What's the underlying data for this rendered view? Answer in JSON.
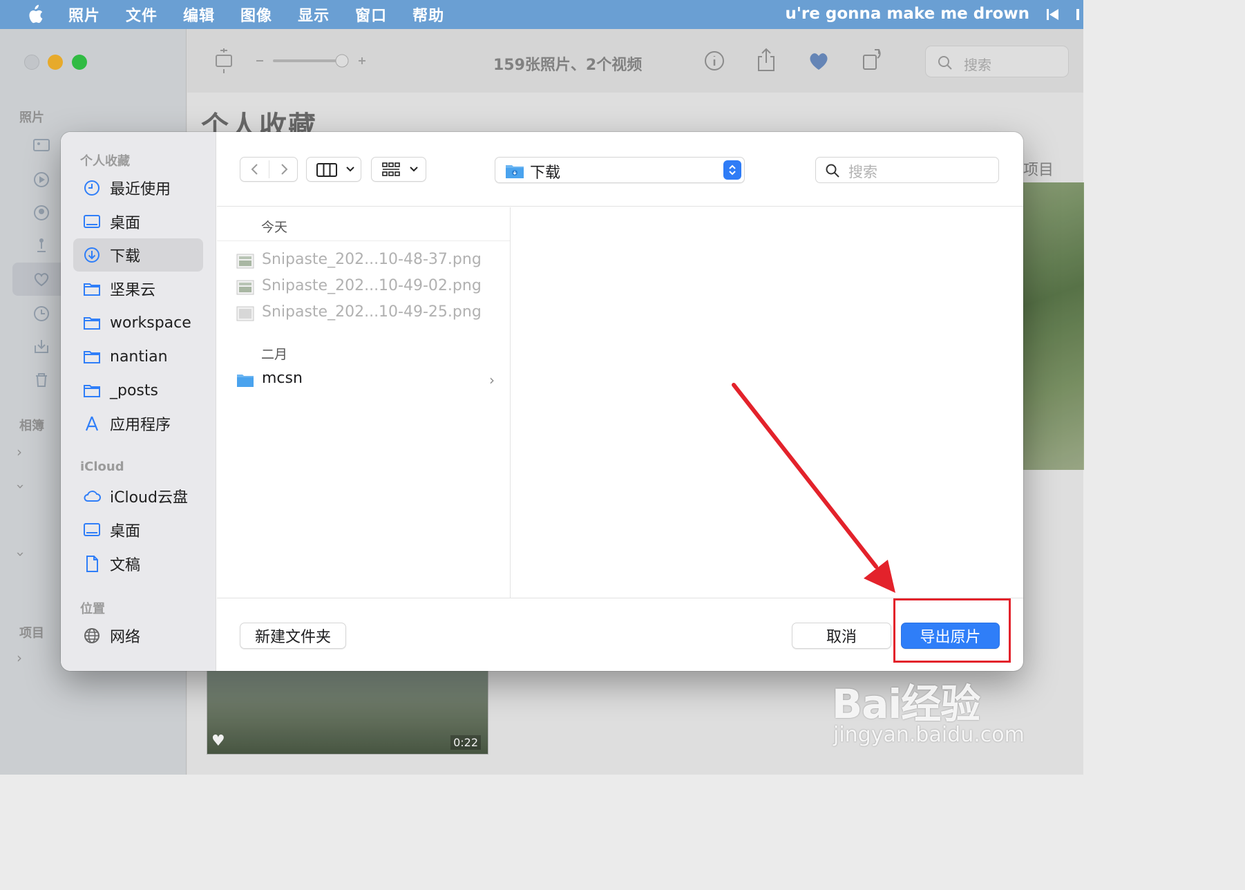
{
  "menubar": {
    "items": [
      "照片",
      "文件",
      "编辑",
      "图像",
      "显示",
      "窗口",
      "帮助"
    ],
    "now_playing": "u're gonna make me drown"
  },
  "background": {
    "sidebar": {
      "section_photos": "照片",
      "section_albums": "相簿",
      "section_projects": "项目"
    },
    "toolbar": {
      "count": "159张照片、2个视频",
      "search_placeholder": "搜索"
    },
    "title": "个人收藏",
    "right_label": "项目",
    "thumb_duration": "0:22"
  },
  "dialog": {
    "sidebar": {
      "favorites_header": "个人收藏",
      "favorites": [
        {
          "label": "最近使用",
          "icon": "clock-icon"
        },
        {
          "label": "桌面",
          "icon": "desktop-icon"
        },
        {
          "label": "下载",
          "icon": "download-icon",
          "selected": true
        },
        {
          "label": "坚果云",
          "icon": "folder-icon"
        },
        {
          "label": "workspace",
          "icon": "folder-icon"
        },
        {
          "label": "nantian",
          "icon": "folder-icon"
        },
        {
          "label": "_posts",
          "icon": "folder-icon"
        },
        {
          "label": "应用程序",
          "icon": "applications-icon"
        }
      ],
      "icloud_header": "iCloud",
      "icloud": [
        {
          "label": "iCloud云盘",
          "icon": "cloud-icon"
        },
        {
          "label": "桌面",
          "icon": "desktop-icon"
        },
        {
          "label": "文稿",
          "icon": "document-icon"
        }
      ],
      "locations_header": "位置",
      "locations": [
        {
          "label": "网络",
          "icon": "globe-icon"
        }
      ]
    },
    "location": "下载",
    "search_placeholder": "搜索",
    "groups": [
      {
        "header": "今天",
        "files": [
          "Snipaste_202...10-48-37.png",
          "Snipaste_202...10-49-02.png",
          "Snipaste_202...10-49-25.png"
        ]
      },
      {
        "header": "二月",
        "files": [
          "mcsn"
        ]
      }
    ],
    "new_folder": "新建文件夹",
    "cancel": "取消",
    "export": "导出原片"
  },
  "watermark": {
    "top": "Bai经验",
    "bottom": "jingyan.baidu.com"
  },
  "colors": {
    "menubar": "#6a9fd3",
    "accent": "#2f7ef8",
    "annotation": "#e3222b"
  }
}
